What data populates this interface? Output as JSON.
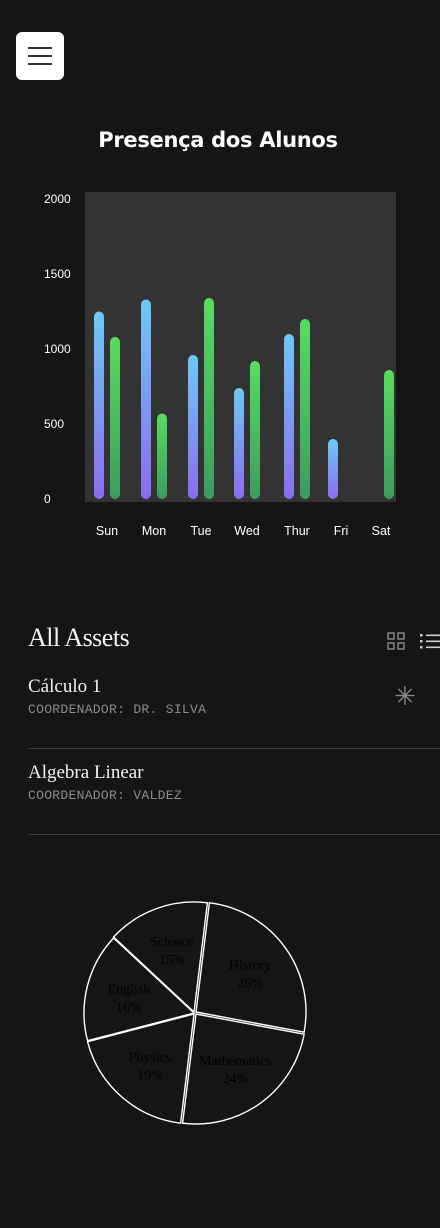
{
  "header": {
    "menu_icon": "hamburger-icon",
    "title": "Presença dos Alunos"
  },
  "assets": {
    "title": "All Assets",
    "view_icons": [
      "grid-icon",
      "list-icon"
    ],
    "items": [
      {
        "name": "Cálculo 1",
        "subtitle": "COORDENADOR: DR. SILVA",
        "icon": "asterisk-icon",
        "icon_glyph": "✳"
      },
      {
        "name": "Algebra Linear",
        "subtitle": "COORDENADOR: VALDEZ"
      }
    ]
  },
  "chart_data": [
    {
      "type": "bar",
      "categories": [
        "Sun",
        "Mon",
        "Tue",
        "Wed",
        "Thur",
        "Fri",
        "Sat"
      ],
      "series": [
        {
          "values": [
            1250,
            1330,
            960,
            740,
            1100,
            400,
            0
          ]
        },
        {
          "values": [
            1080,
            570,
            1340,
            920,
            1200,
            0,
            860
          ]
        }
      ],
      "yticks": [
        0,
        500,
        1000,
        1500,
        2000
      ],
      "ylim": [
        0,
        2000
      ],
      "colors": {
        "series1_top": "#6ec9f5",
        "series1_bottom": "#8a6cf0",
        "series2_top": "#56dd5f",
        "series2_bottom": "#3f9a60",
        "plot_bg": "#333333",
        "tick_label": "#ffffff"
      }
    },
    {
      "type": "pie",
      "slices": [
        {
          "label": "History",
          "value": 26
        },
        {
          "label": "Mathematics",
          "value": 24
        },
        {
          "label": "Physics",
          "value": 19
        },
        {
          "label": "English",
          "value": 16
        },
        {
          "label": "Science",
          "value": 15
        }
      ],
      "value_suffix": "%",
      "colors": {
        "stroke": "#ffffff",
        "label": "#000000"
      }
    }
  ]
}
